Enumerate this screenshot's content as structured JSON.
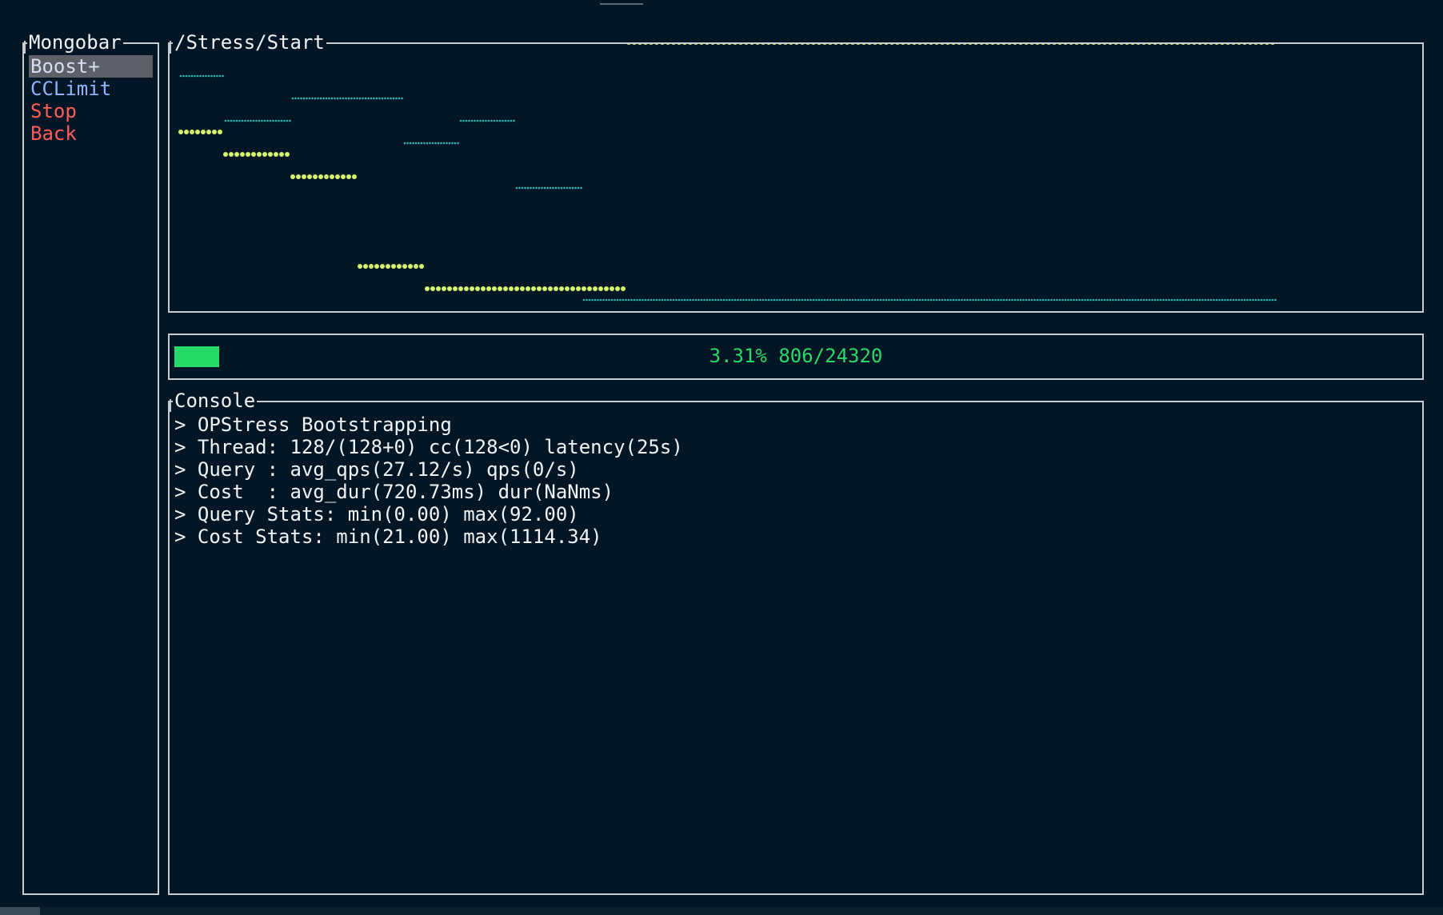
{
  "sidebar": {
    "title": "Mongobar",
    "items": [
      {
        "label": "Boost+"
      },
      {
        "label": "CCLimit"
      },
      {
        "label": "Stop"
      },
      {
        "label": "Back"
      }
    ]
  },
  "chart": {
    "title": "/Stress/Start"
  },
  "chart_data": {
    "type": "line",
    "title": "/Stress/Start",
    "series": [
      {
        "color": "#d6f56a",
        "style": "dots",
        "values": [
          7,
          7,
          7,
          7,
          6,
          6,
          6,
          6,
          6,
          6,
          5,
          5,
          5,
          5,
          5,
          5,
          1,
          1,
          1,
          1,
          1,
          1,
          0,
          0,
          0,
          0,
          0,
          0,
          0,
          0,
          0,
          0,
          0,
          0,
          0,
          0,
          0,
          0,
          0,
          0,
          11,
          11,
          11,
          11,
          11,
          11,
          11,
          11,
          11,
          11,
          11,
          11,
          11,
          11,
          11,
          11,
          11,
          11,
          11,
          11,
          11,
          11,
          11,
          11,
          11,
          11,
          11,
          11,
          11,
          11,
          11,
          11,
          11,
          11,
          11,
          11,
          11,
          11,
          11,
          11,
          11,
          11,
          11,
          11,
          11,
          11,
          11,
          11,
          11,
          11,
          11,
          11,
          11,
          11,
          11,
          11,
          11,
          11
        ]
      },
      {
        "color": "#2bb5b0",
        "style": "braille",
        "values": [
          10,
          10,
          10,
          10,
          8,
          8,
          8,
          8,
          8,
          8,
          9,
          9,
          9,
          9,
          9,
          9,
          9,
          9,
          9,
          9,
          7,
          7,
          7,
          7,
          7,
          8,
          8,
          8,
          8,
          8,
          5,
          5,
          5,
          5,
          5,
          5,
          0,
          0,
          0,
          0,
          0,
          0,
          0,
          0,
          0,
          0,
          0,
          0,
          0,
          0,
          0,
          0,
          0,
          0,
          0,
          0,
          0,
          0,
          0,
          0,
          0,
          0,
          0,
          0,
          0,
          0,
          0,
          0,
          0,
          0,
          0,
          0,
          0,
          0,
          0,
          0,
          0,
          0,
          0,
          0,
          0,
          0,
          0,
          0,
          0,
          0,
          0,
          0,
          0,
          0,
          0,
          0,
          0,
          0,
          0,
          0,
          0,
          0
        ]
      }
    ]
  },
  "progress": {
    "percent": 3.31,
    "text": "3.31% 806/24320",
    "color": "#27d968"
  },
  "console": {
    "title": "Console",
    "lines": [
      "> OPStress Bootstrapping",
      "> Thread: 128/(128+0) cc(128<0) latency(25s)",
      "> Query : avg_qps(27.12/s) qps(0/s)",
      "> Cost  : avg_dur(720.73ms) dur(NaNms)",
      "> Query Stats: min(0.00) max(92.00)",
      "> Cost Stats: min(21.00) max(1114.34)"
    ]
  }
}
